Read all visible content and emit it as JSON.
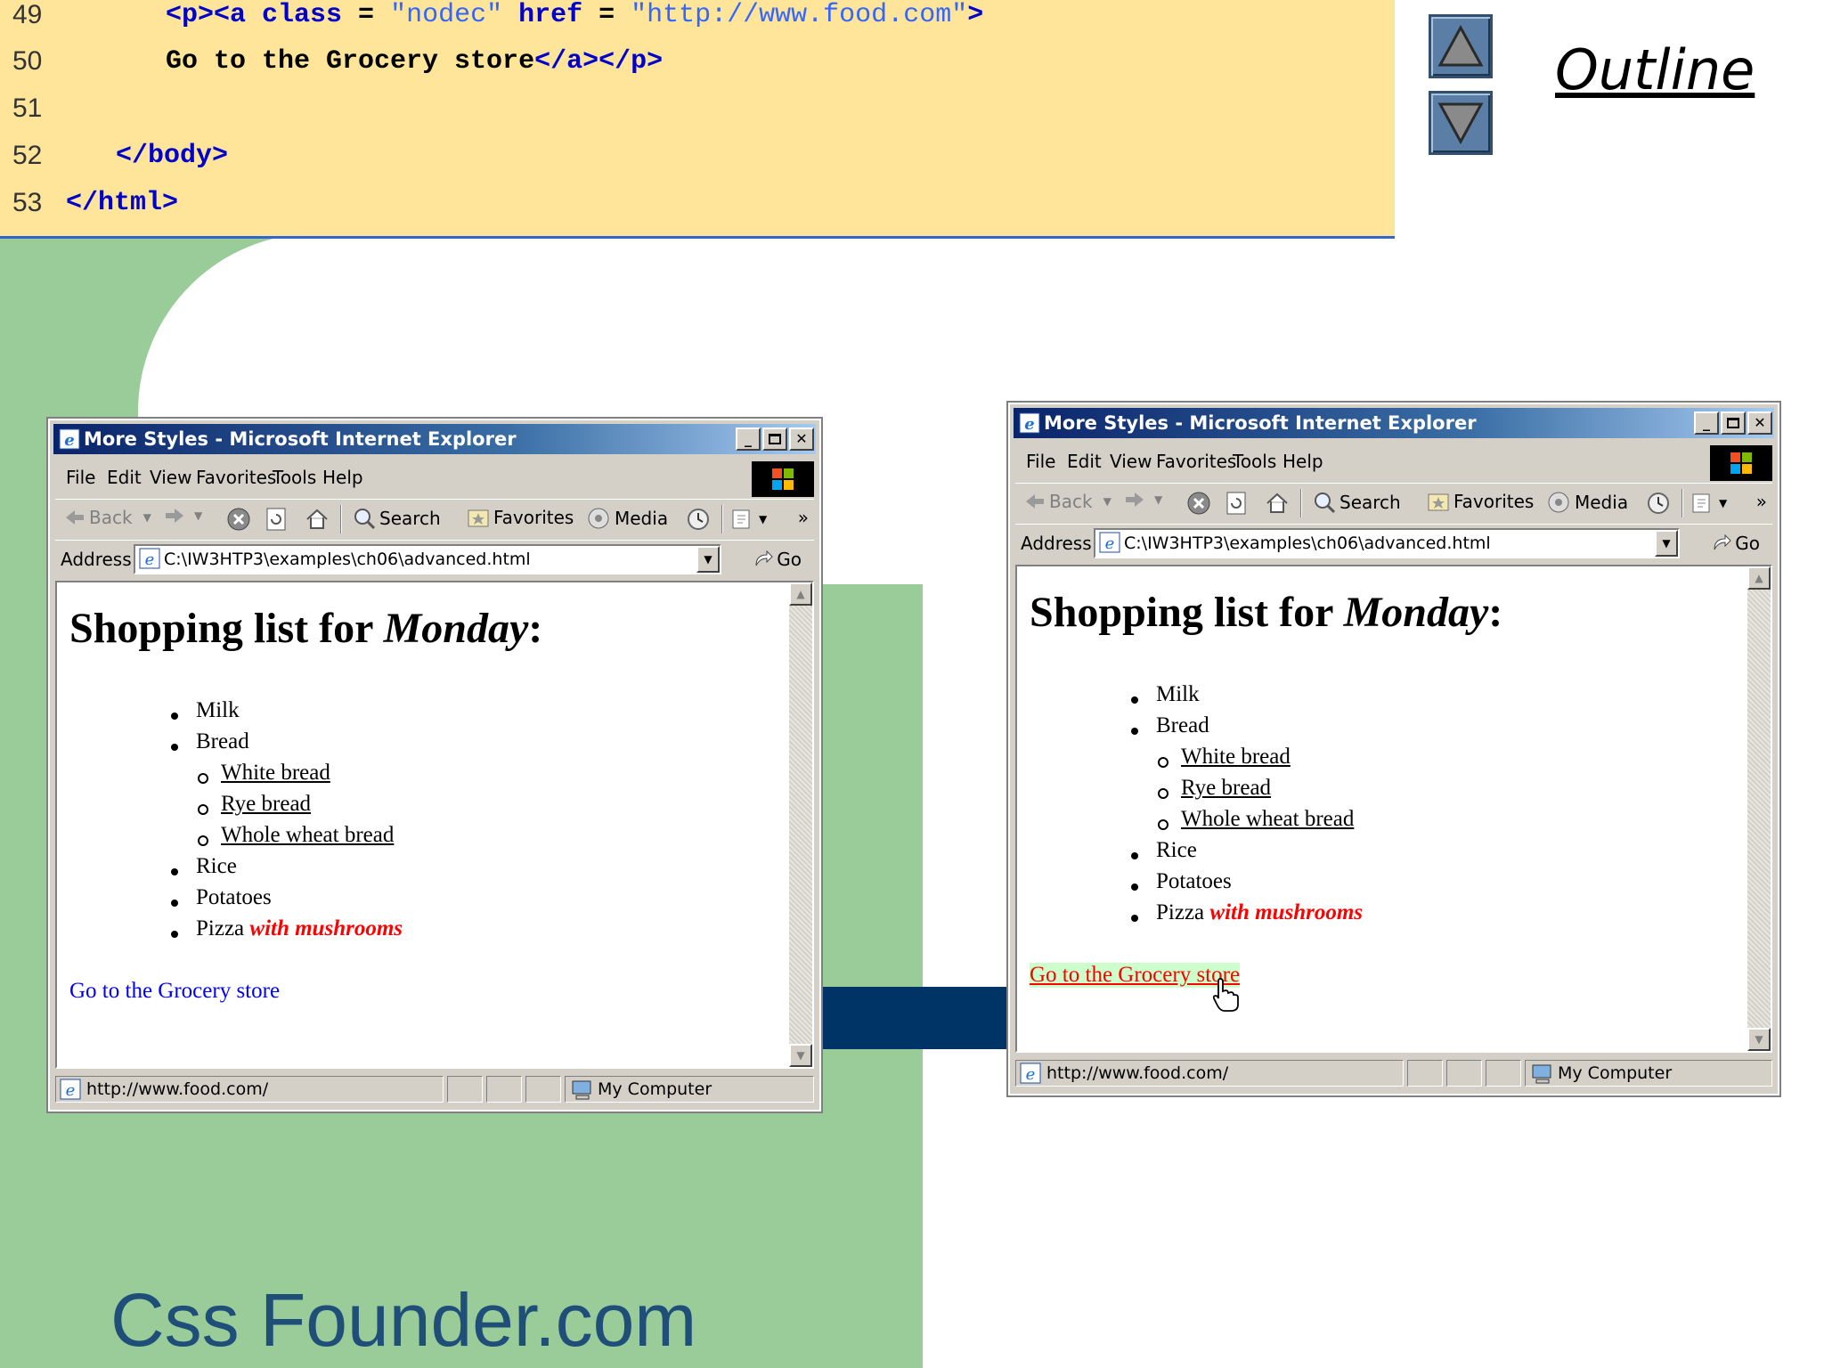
{
  "code": {
    "lines": [
      {
        "no": "49",
        "parts": [
          [
            "tag",
            "<p><a "
          ],
          [
            "attr",
            "class"
          ],
          [
            "txt",
            " = "
          ],
          [
            "val",
            "\"nodec\""
          ],
          [
            "txt",
            " "
          ],
          [
            "attr",
            "href"
          ],
          [
            "txt",
            " = "
          ],
          [
            "val",
            "\"http://www.food.com\""
          ],
          [
            "tag",
            ">"
          ]
        ]
      },
      {
        "no": "50",
        "parts": [
          [
            "txt",
            "Go to the Grocery store"
          ],
          [
            "tag",
            "</a></p>"
          ]
        ]
      },
      {
        "no": "51",
        "parts": []
      },
      {
        "no": "52",
        "parts": [
          [
            "tag",
            "</body>"
          ]
        ]
      },
      {
        "no": "53",
        "parts": [
          [
            "tag",
            "</html>"
          ]
        ]
      }
    ]
  },
  "outline": {
    "title": "Outline"
  },
  "footer": {
    "brand": "Css Founder.com"
  },
  "browser": {
    "title": "More Styles - Microsoft Internet Explorer",
    "menu": [
      "File",
      "Edit",
      "View",
      "Favorites",
      "Tools",
      "Help"
    ],
    "toolbar": {
      "back": "Back",
      "search": "Search",
      "favorites": "Favorites",
      "media": "Media"
    },
    "address_label": "Address",
    "address_value": "C:\\IW3HTP3\\examples\\ch06\\advanced.html",
    "go": "Go",
    "status_url": "http://www.food.com/",
    "status_zone": "My Computer"
  },
  "page": {
    "heading_prefix": "Shopping list for ",
    "heading_day": "Monday",
    "heading_suffix": ":",
    "items": [
      "Milk",
      "Bread",
      "Rice",
      "Potatoes"
    ],
    "bread_types": [
      "White bread",
      "Rye bread",
      "Whole wheat bread"
    ],
    "pizza": "Pizza",
    "pizza_emph": "with mushrooms",
    "link": "Go to the Grocery store"
  },
  "colors": {
    "code_bg": "#ffe599",
    "slide_green": "#99cc99",
    "navy": "#003366",
    "link_hover": "#ff0000",
    "link_hover_bg": "#ccffcc",
    "link_normal": "#0000ff"
  }
}
